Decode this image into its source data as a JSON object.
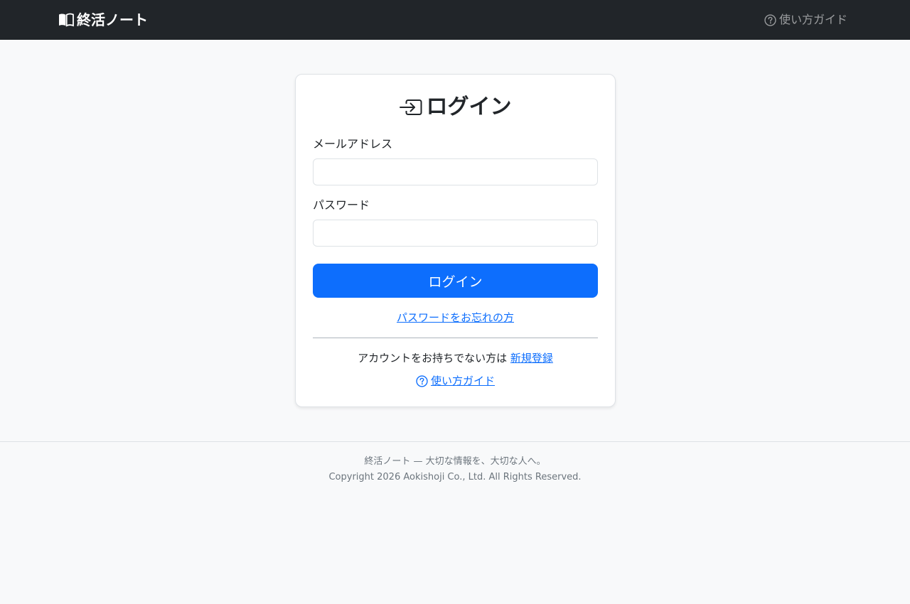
{
  "navbar": {
    "brand": "終活ノート",
    "guide_link": "使い方ガイド"
  },
  "login_card": {
    "title": "ログイン",
    "email_label": "メールアドレス",
    "email_value": "",
    "password_label": "パスワード",
    "password_value": "",
    "submit_label": "ログイン",
    "forgot_link": "パスワードをお忘れの方",
    "signup_prompt": "アカウントをお持ちでない方は",
    "signup_link": "新規登録",
    "guide_link": "使い方ガイド"
  },
  "footer": {
    "tagline": "終活ノート — 大切な情報を、大切な人へ。",
    "copyright": "Copyright 2026 Aokishoji Co., Ltd. All Rights Reserved."
  },
  "colors": {
    "navbar_bg": "#212529",
    "primary": "#0d6efd",
    "page_bg": "#f8f9fa"
  },
  "icons": {
    "brand": "book-icon",
    "guide": "question-circle-icon",
    "login": "box-arrow-in-right-icon"
  }
}
